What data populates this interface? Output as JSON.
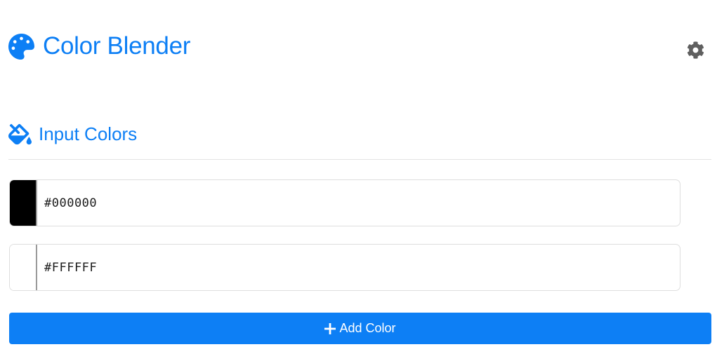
{
  "header": {
    "title": "Color Blender",
    "logo_icon": "palette-icon",
    "settings_icon": "gear-icon"
  },
  "section": {
    "title": "Input Colors",
    "icon": "paint-bucket-icon"
  },
  "colors": [
    {
      "value": "#000000",
      "swatch": "#000000"
    },
    {
      "value": "#FFFFFF",
      "swatch": "#FFFFFF"
    }
  ],
  "add_button": {
    "label": "Add Color",
    "icon": "plus-icon"
  },
  "theme": {
    "accent": "#0d7ff5",
    "icon_gray": "#5f5f5f",
    "border": "#dedede"
  }
}
